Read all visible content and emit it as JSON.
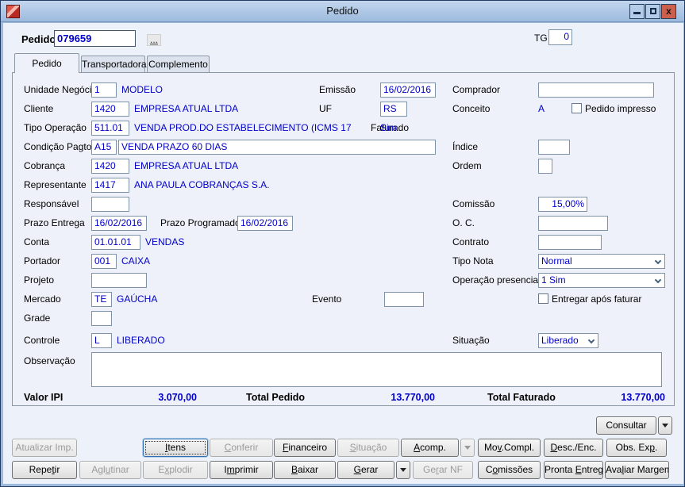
{
  "window": {
    "title": "Pedido",
    "controls": {
      "close_glyph": "x"
    }
  },
  "header": {
    "pedido_label": "Pedido",
    "pedido_value": "079659",
    "ellipsis": "...",
    "tg_label": "TG",
    "tg_value": "0"
  },
  "tabs": [
    {
      "label": "Pedido",
      "active": true
    },
    {
      "label": "Transportadora",
      "active": false
    },
    {
      "label": "Complemento",
      "active": false
    }
  ],
  "fields": {
    "unidade_negocio": {
      "label": "Unidade Negócio",
      "code": "1",
      "desc": "MODELO"
    },
    "cliente": {
      "label": "Cliente",
      "code": "1420",
      "desc": "EMPRESA ATUAL LTDA"
    },
    "tipo_operacao": {
      "label": "Tipo Operação",
      "code": "511.01",
      "desc": "VENDA PROD.DO ESTABELECIMENTO (ICMS 17"
    },
    "condicao_pagto": {
      "label": "Condição Pagto.",
      "code": "A15",
      "desc": "VENDA PRAZO 60 DIAS"
    },
    "cobranca": {
      "label": "Cobrança",
      "code": "1420",
      "desc": "EMPRESA ATUAL LTDA"
    },
    "representante": {
      "label": "Representante",
      "code": "1417",
      "desc": "ANA PAULA COBRANÇAS S.A."
    },
    "responsavel": {
      "label": "Responsável",
      "code": ""
    },
    "prazo_entrega": {
      "label": "Prazo Entrega",
      "value": "16/02/2016"
    },
    "prazo_programado": {
      "label": "Prazo Programado",
      "value": "16/02/2016"
    },
    "conta": {
      "label": "Conta",
      "code": "01.01.01",
      "desc": "VENDAS"
    },
    "portador": {
      "label": "Portador",
      "code": "001",
      "desc": "CAIXA"
    },
    "projeto": {
      "label": "Projeto",
      "value": ""
    },
    "mercado": {
      "label": "Mercado",
      "code": "TE",
      "desc": "GAÚCHA"
    },
    "grade": {
      "label": "Grade",
      "value": ""
    },
    "controle": {
      "label": "Controle",
      "code": "L",
      "desc": "LIBERADO"
    },
    "observacao": {
      "label": "Observação",
      "value": ""
    },
    "emissao": {
      "label": "Emissão",
      "value": "16/02/2016"
    },
    "uf": {
      "label": "UF",
      "value": "RS"
    },
    "faturado": {
      "label": "Faturado",
      "value": "Sim"
    },
    "evento": {
      "label": "Evento",
      "value": ""
    },
    "comprador": {
      "label": "Comprador",
      "value": ""
    },
    "conceito": {
      "label": "Conceito",
      "value": "A"
    },
    "pedido_impresso": {
      "label": "Pedido impresso",
      "checked": false
    },
    "indice": {
      "label": "Índice",
      "value": ""
    },
    "ordem": {
      "label": "Ordem",
      "value": ""
    },
    "comissao": {
      "label": "Comissão",
      "value": "15,00%"
    },
    "oc": {
      "label": "O. C.",
      "value": ""
    },
    "contrato": {
      "label": "Contrato",
      "value": ""
    },
    "tipo_nota": {
      "label": "Tipo Nota",
      "value": "Normal"
    },
    "operacao_presencial": {
      "label": "Operação presencial",
      "value": "1 Sim"
    },
    "entregar_apos_faturar": {
      "label": "Entregar após faturar",
      "checked": false
    },
    "situacao": {
      "label": "Situação",
      "value": "Liberado"
    }
  },
  "totals": {
    "valor_ipi_label": "Valor IPI",
    "valor_ipi": "3.070,00",
    "total_pedido_label": "Total Pedido",
    "total_pedido": "13.770,00",
    "total_faturado_label": "Total Faturado",
    "total_faturado": "13.770,00"
  },
  "actions": {
    "consultar": {
      "label": "Consultar",
      "mn": -1
    },
    "atualizar_imp": {
      "label": "Atualizar Imp.",
      "mn": -1
    },
    "itens": {
      "label": "Itens",
      "mn": 0
    },
    "conferir": {
      "label": "Conferir",
      "mn": 0
    },
    "financeiro": {
      "label": "Financeiro",
      "mn": 0
    },
    "situacao_btn": {
      "label": "Situação",
      "mn": 0
    },
    "acomp": {
      "label": "Acomp.",
      "mn": 0
    },
    "mov_compl": {
      "label": "Mov.Compl.",
      "mn": 2
    },
    "desc_enc": {
      "label": "Desc./Enc.",
      "mn": 0
    },
    "obs_exp": {
      "label": "Obs. Exp.",
      "mn": 7
    },
    "repetir": {
      "label": "Repetir",
      "mn": 4
    },
    "aglutinar": {
      "label": "Aglutinar",
      "mn": 3
    },
    "explodir": {
      "label": "Explodir",
      "mn": 1
    },
    "imprimir": {
      "label": "Imprimir",
      "mn": 1
    },
    "baixar": {
      "label": "Baixar",
      "mn": 0
    },
    "gerar": {
      "label": "Gerar",
      "mn": 0
    },
    "gerar_nf": {
      "label": "Gerar NF",
      "mn": 2
    },
    "comissoes": {
      "label": "Comissões",
      "mn": 1
    },
    "pronta_entrega": {
      "label": "Pronta Entrega",
      "mn": 7
    },
    "avaliar_margem": {
      "label": "Avaliar Margem",
      "mn": 3
    }
  },
  "colors": {
    "value_text": "#0000c8",
    "titlebar": "#9cbade",
    "close_button": "#cd5f4d",
    "background": "#edf1f9"
  }
}
